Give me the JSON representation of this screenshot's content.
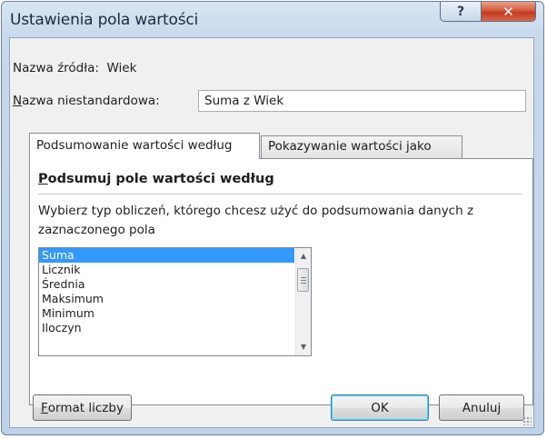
{
  "dialog": {
    "title": "Ustawienia pola wartości",
    "help_label": "?",
    "close_label": "✕"
  },
  "source": {
    "label": "Nazwa źródła:",
    "value": "Wiek"
  },
  "custom_name": {
    "label_accel": "N",
    "label_rest": "azwa niestandardowa:",
    "value": "Suma z Wiek"
  },
  "tabs": [
    {
      "label": "Podsumowanie wartości według",
      "active": true
    },
    {
      "label": "Pokazywanie wartości jako",
      "active": false
    }
  ],
  "summarize": {
    "heading_accel": "P",
    "heading_rest": "odsumuj pole wartości według",
    "description": "Wybierz typ obliczeń, którego chcesz użyć do podsumowania danych z zaznaczonego pola",
    "items": [
      "Suma",
      "Licznik",
      "Średnia",
      "Maksimum",
      "Minimum",
      "Iloczyn"
    ],
    "selected_item": "Suma"
  },
  "buttons": {
    "format_accel": "F",
    "format_rest": "ormat liczby",
    "ok": "OK",
    "cancel": "Anuluj"
  },
  "icons": {
    "scroll_up": "scroll-up-arrow-icon",
    "scroll_down": "scroll-down-arrow-icon",
    "resize_grip": "resize-grip-icon"
  },
  "colors": {
    "selection": "#3399ff",
    "close_button": "#c4391f",
    "frame": "#c8d9ec"
  }
}
